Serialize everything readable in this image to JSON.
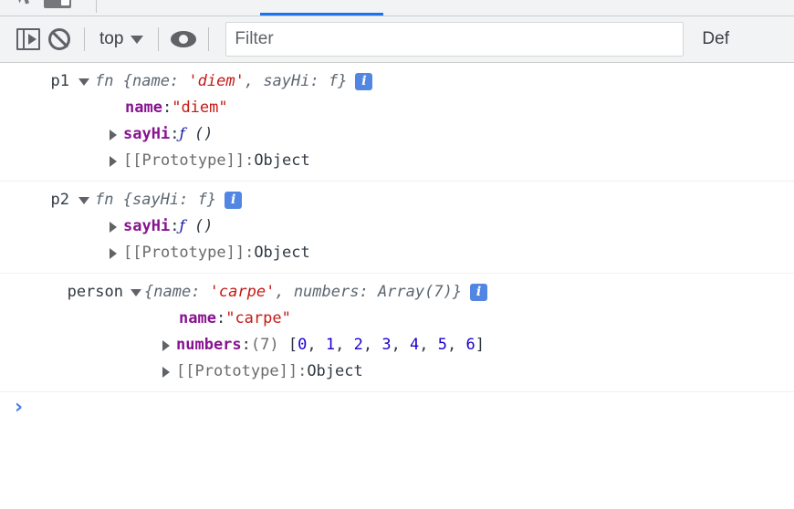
{
  "tabstrip": {
    "icons": [
      "inspect-cursor-icon",
      "device-toolbar-icon"
    ],
    "active_tab_accent": "#1a73e8"
  },
  "toolbar": {
    "sidebar_toggle_name": "show-console-sidebar",
    "clear_console_name": "clear-console",
    "context_label": "top",
    "eye_label": "live-expressions",
    "filter": {
      "value": "",
      "placeholder": "Filter"
    },
    "levels_label": "Def"
  },
  "console": {
    "entries": [
      {
        "label": "p1",
        "preview_prefix": "fn",
        "preview": "{name: 'diem', sayHi: f}",
        "preview_parts": {
          "open": "{",
          "k1": "name: ",
          "v1": "'diem'",
          "sep": ", ",
          "k2": "sayHi: ",
          "v2": "f",
          "close": "}"
        },
        "badge": "i",
        "children": [
          {
            "arrow": false,
            "key": "name",
            "colon": ": ",
            "value": "\"diem\"",
            "value_type": "string"
          },
          {
            "arrow": true,
            "key": "sayHi",
            "colon": ": ",
            "value": "f ()",
            "value_type": "function"
          },
          {
            "arrow": true,
            "key": "[[Prototype]]",
            "colon": ": ",
            "value": "Object",
            "value_type": "proto"
          }
        ]
      },
      {
        "label": "p2",
        "preview_prefix": "fn",
        "preview": "{sayHi: f}",
        "preview_parts": {
          "open": "{",
          "k1": "sayHi: ",
          "v1": "f",
          "close": "}"
        },
        "badge": "i",
        "children": [
          {
            "arrow": true,
            "key": "sayHi",
            "colon": ": ",
            "value": "f ()",
            "value_type": "function"
          },
          {
            "arrow": true,
            "key": "[[Prototype]]",
            "colon": ": ",
            "value": "Object",
            "value_type": "proto"
          }
        ]
      },
      {
        "label": "person",
        "preview_prefix": "",
        "preview": "{name: 'carpe', numbers: Array(7)}",
        "preview_parts": {
          "open": "{",
          "k1": "name: ",
          "v1": "'carpe'",
          "sep": ", ",
          "k2": "numbers: ",
          "v2": "Array(7)",
          "close": "}"
        },
        "badge": "i",
        "children": [
          {
            "arrow": false,
            "key": "name",
            "colon": ": ",
            "value": "\"carpe\"",
            "value_type": "string"
          },
          {
            "arrow": true,
            "key": "numbers",
            "colon": ": ",
            "count": "(7)",
            "array": [
              "0",
              "1",
              "2",
              "3",
              "4",
              "5",
              "6"
            ],
            "value_type": "array"
          },
          {
            "arrow": true,
            "key": "[[Prototype]]",
            "colon": ": ",
            "value": "Object",
            "value_type": "proto"
          }
        ]
      }
    ],
    "prompt_symbol": "›"
  }
}
